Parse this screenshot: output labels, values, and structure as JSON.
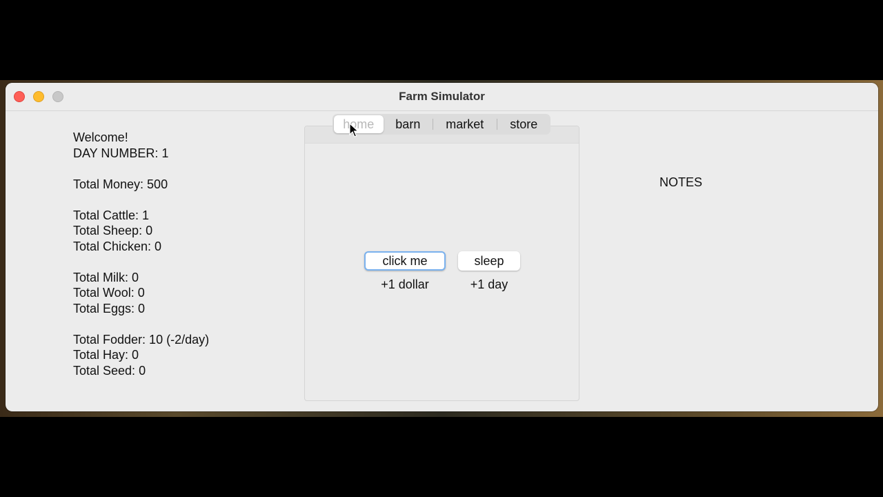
{
  "window": {
    "title": "Farm Simulator"
  },
  "stats": {
    "welcome": "Welcome!",
    "day": "DAY NUMBER: 1",
    "money": "Total Money: 500",
    "cattle": "Total Cattle: 1",
    "sheep": "Total Sheep: 0",
    "chicken": "Total Chicken: 0",
    "milk": "Total Milk: 0",
    "wool": "Total Wool: 0",
    "eggs": "Total Eggs: 0",
    "fodder": "Total Fodder: 10 (-2/day)",
    "hay": "Total Hay: 0",
    "seed": "Total Seed: 0"
  },
  "tabs": [
    {
      "label": "home",
      "active": true
    },
    {
      "label": "barn"
    },
    {
      "label": "market"
    },
    {
      "label": "store"
    }
  ],
  "home": {
    "click_label": "click me",
    "click_caption": "+1 dollar",
    "sleep_label": "sleep",
    "sleep_caption": "+1 day"
  },
  "notes": {
    "label": "NOTES"
  },
  "colors": {
    "close": "#fe5f57",
    "minimize": "#febc2e",
    "maximize_disabled": "#c8c8c8",
    "focus_ring": "#7ab1ee"
  }
}
